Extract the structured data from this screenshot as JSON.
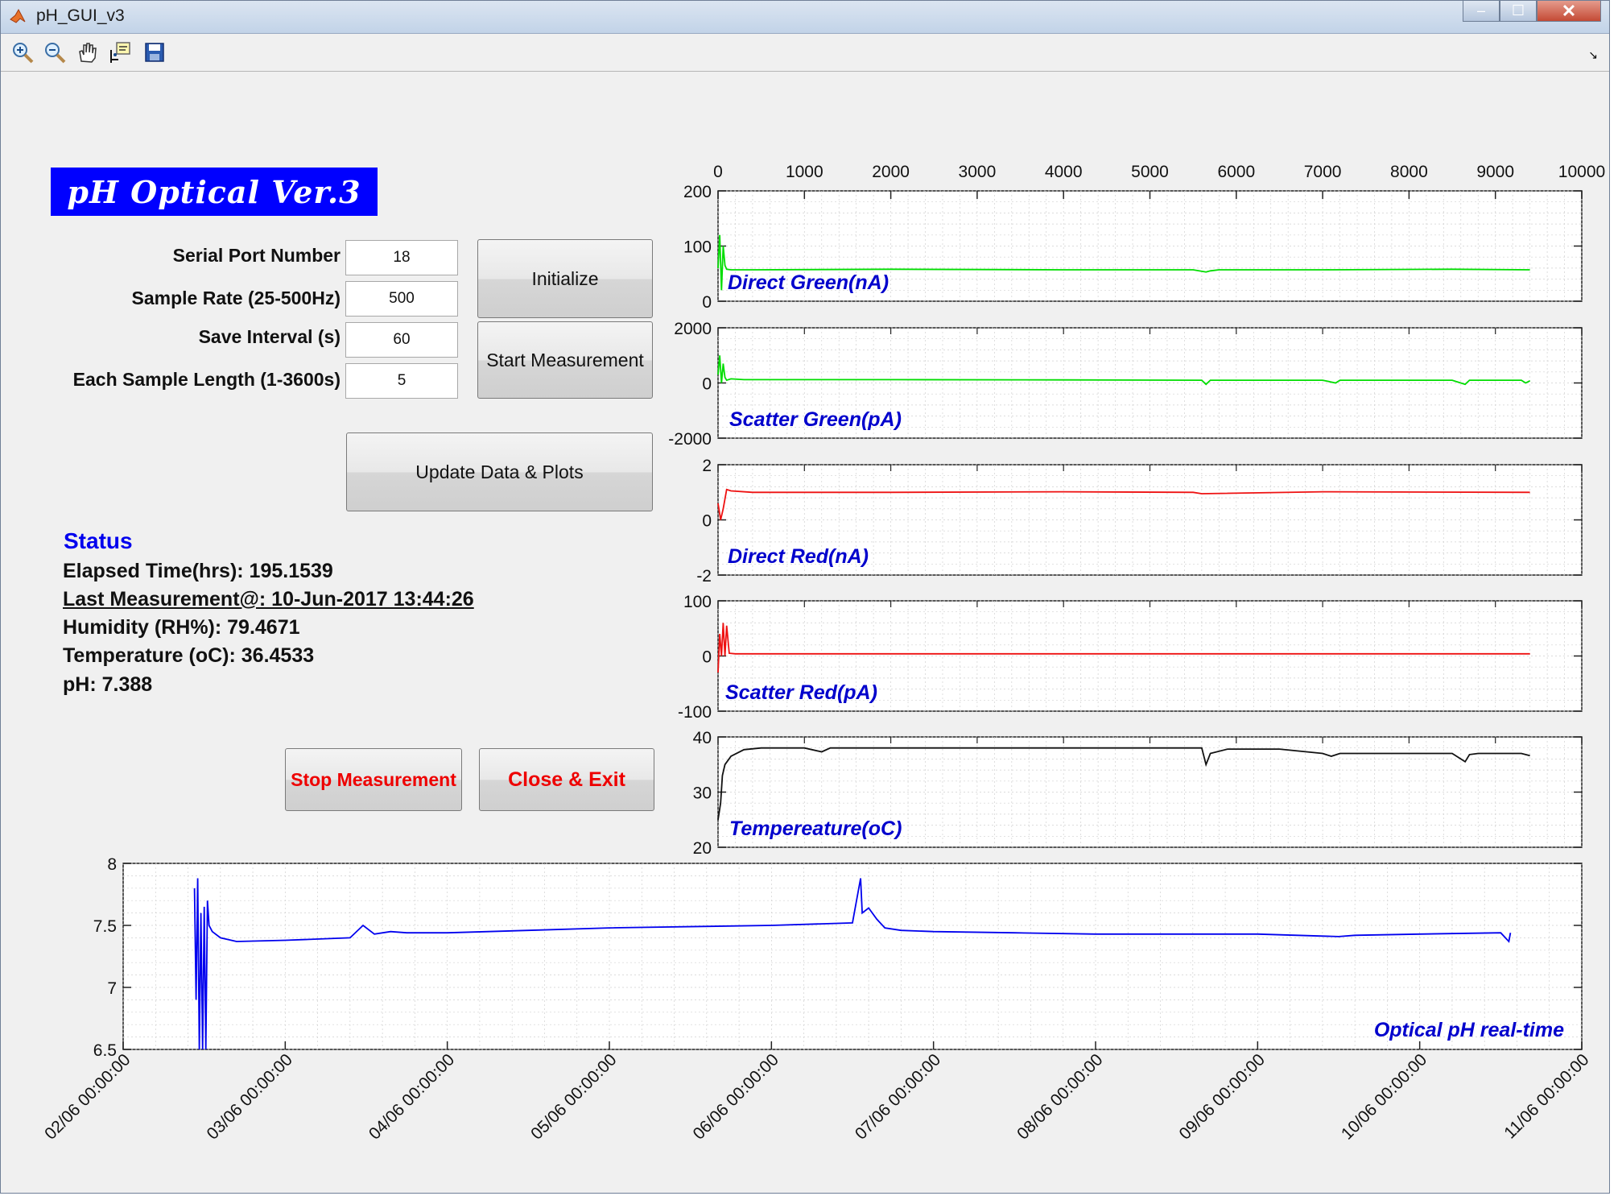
{
  "window": {
    "title": "pH_GUI_v3",
    "minimize": "–",
    "maximize": "☐",
    "close": "✕"
  },
  "toolbar": {
    "icons": [
      "zoom-in-icon",
      "zoom-out-icon",
      "pan-hand-icon",
      "data-cursor-icon",
      "save-icon"
    ],
    "dock_arrow": "↘"
  },
  "logo": {
    "text": "pH Optical Ver.3"
  },
  "settings": {
    "serial_port_label": "Serial Port Number",
    "serial_port_value": "18",
    "sample_rate_label": "Sample Rate (25-500Hz)",
    "sample_rate_value": "500",
    "save_interval_label": "Save Interval (s)",
    "save_interval_value": "60",
    "sample_length_label": "Each Sample Length (1-3600s)",
    "sample_length_value": "5"
  },
  "buttons": {
    "initialize": "Initialize",
    "start": "Start Measurement",
    "update": "Update Data & Plots",
    "stop": "Stop Measurement",
    "close": "Close & Exit"
  },
  "status": {
    "title": "Status",
    "elapsed": "Elapsed Time(hrs): 195.1539",
    "last": "Last Measurement@: 10-Jun-2017 13:44:26",
    "humidity": "Humidity (RH%): 79.4671",
    "temperature": "Temperature (oC): 36.4533",
    "ph": "pH: 7.388"
  },
  "colors": {
    "green": "#00dd00",
    "red": "#ee1111",
    "black": "#111111",
    "blue": "#0000ee",
    "label": "#0000cc"
  },
  "chart_data": [
    {
      "type": "line",
      "title": "Direct Green(nA)",
      "xlim": [
        0,
        10000
      ],
      "ylim": [
        0,
        200
      ],
      "yticks": [
        0,
        100,
        200
      ],
      "xticks": [
        0,
        1000,
        2000,
        3000,
        4000,
        5000,
        6000,
        7000,
        8000,
        9000,
        10000
      ],
      "color": "#00dd00",
      "series": [
        {
          "x": [
            0,
            20,
            40,
            60,
            80,
            100,
            150,
            400,
            2000,
            4000,
            5500,
            5650,
            5700,
            5800,
            7000,
            8500,
            9400
          ],
          "y": [
            60,
            120,
            20,
            100,
            65,
            58,
            57,
            57,
            58,
            57,
            57,
            53,
            55,
            57,
            57,
            58,
            57
          ]
        }
      ]
    },
    {
      "type": "line",
      "title": "Scatter Green(pA)",
      "xlim": [
        0,
        10000
      ],
      "ylim": [
        -2000,
        2000
      ],
      "yticks": [
        -2000,
        0,
        2000
      ],
      "color": "#00dd00",
      "series": [
        {
          "x": [
            0,
            20,
            40,
            60,
            80,
            100,
            150,
            300,
            2000,
            4000,
            5600,
            5650,
            5700,
            7000,
            7150,
            7200,
            8500,
            8650,
            8700,
            9300,
            9350,
            9400
          ],
          "y": [
            300,
            1000,
            0,
            700,
            200,
            100,
            150,
            120,
            120,
            110,
            100,
            -50,
            100,
            100,
            0,
            100,
            100,
            -50,
            100,
            100,
            0,
            80
          ]
        }
      ]
    },
    {
      "type": "line",
      "title": "Direct Red(nA)",
      "xlim": [
        0,
        10000
      ],
      "ylim": [
        -2,
        2
      ],
      "yticks": [
        -2,
        0,
        2
      ],
      "color": "#ee1111",
      "series": [
        {
          "x": [
            0,
            30,
            60,
            100,
            150,
            400,
            2000,
            4000,
            5500,
            5600,
            7000,
            9400
          ],
          "y": [
            0.6,
            0,
            0.4,
            1.1,
            1.05,
            1.0,
            1.0,
            1.02,
            1.0,
            0.95,
            1.02,
            1.0
          ]
        }
      ]
    },
    {
      "type": "line",
      "title": "Scatter Red(pA)",
      "xlim": [
        0,
        10000
      ],
      "ylim": [
        -100,
        100
      ],
      "yticks": [
        -100,
        0,
        100
      ],
      "color": "#ee1111",
      "series": [
        {
          "x": [
            0,
            20,
            40,
            60,
            80,
            100,
            130,
            200,
            2000,
            5600,
            9400
          ],
          "y": [
            -30,
            40,
            0,
            60,
            0,
            55,
            5,
            4,
            4,
            4,
            4
          ]
        }
      ]
    },
    {
      "type": "line",
      "title": "Tempereature(oC)",
      "xlim": [
        0,
        10000
      ],
      "ylim": [
        20,
        40
      ],
      "yticks": [
        20,
        30,
        40
      ],
      "color": "#111111",
      "series": [
        {
          "x": [
            0,
            30,
            50,
            80,
            150,
            300,
            500,
            1000,
            1200,
            1300,
            2000,
            4000,
            5400,
            5600,
            5650,
            5700,
            5900,
            6500,
            7000,
            7100,
            7200,
            8000,
            8500,
            8650,
            8700,
            8800,
            9300,
            9400
          ],
          "y": [
            25,
            28,
            33,
            35,
            36.5,
            37.7,
            38,
            38,
            37.3,
            38,
            38,
            38,
            38,
            38,
            35,
            37,
            37.8,
            37.8,
            37,
            36.5,
            37,
            37,
            37,
            35.5,
            36.8,
            37,
            37,
            36.6
          ]
        }
      ]
    },
    {
      "type": "line",
      "title": "Optical pH real-time",
      "ylim": [
        6.5,
        8
      ],
      "yticks": [
        6.5,
        7,
        7.5,
        8
      ],
      "xticks": [
        "02/06 00:00:00",
        "03/06 00:00:00",
        "04/06 00:00:00",
        "05/06 00:00:00",
        "06/06 00:00:00",
        "07/06 00:00:00",
        "08/06 00:00:00",
        "09/06 00:00:00",
        "10/06 00:00:00",
        "11/06 00:00:00"
      ],
      "x_unit": "days",
      "xlim": [
        0,
        9
      ],
      "color": "#0000ee",
      "series": [
        {
          "x": [
            0.44,
            0.45,
            0.46,
            0.47,
            0.48,
            0.49,
            0.5,
            0.51,
            0.52,
            0.53,
            0.55,
            0.6,
            0.7,
            1.0,
            1.4,
            1.48,
            1.55,
            1.65,
            1.75,
            2.0,
            2.5,
            3.0,
            4.0,
            4.5,
            4.55,
            4.56,
            4.6,
            4.65,
            4.7,
            4.8,
            5.0,
            5.5,
            6.0,
            7.0,
            7.5,
            7.6,
            8.0,
            8.5,
            8.55,
            8.56
          ],
          "y": [
            7.8,
            6.9,
            7.88,
            6.5,
            7.6,
            6.5,
            7.65,
            6.5,
            7.7,
            7.5,
            7.45,
            7.4,
            7.37,
            7.38,
            7.4,
            7.5,
            7.43,
            7.45,
            7.44,
            7.44,
            7.46,
            7.48,
            7.5,
            7.52,
            7.88,
            7.6,
            7.64,
            7.55,
            7.48,
            7.46,
            7.45,
            7.44,
            7.43,
            7.43,
            7.41,
            7.42,
            7.43,
            7.44,
            7.37,
            7.44
          ]
        }
      ]
    }
  ]
}
